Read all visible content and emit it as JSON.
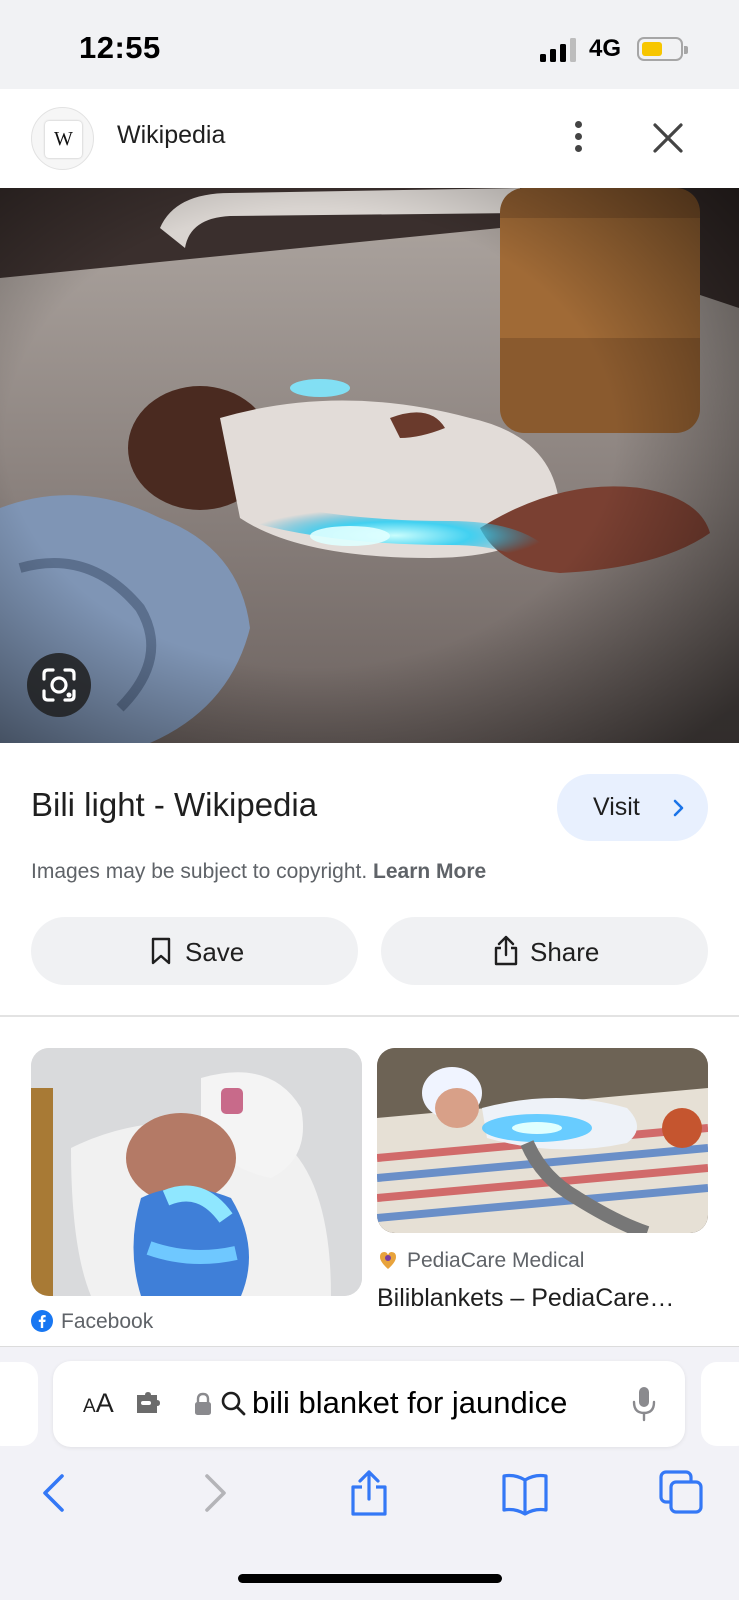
{
  "status_bar": {
    "time": "12:55",
    "network": "4G"
  },
  "header": {
    "logo_letter": "W",
    "site_name": "Wikipedia"
  },
  "result": {
    "title": "Bili light - Wikipedia",
    "visit_label": "Visit",
    "copyright_text": "Images may be subject to copyright.",
    "learn_more": "Learn More",
    "save_label": "Save",
    "share_label": "Share"
  },
  "related": [
    {
      "source": "Facebook",
      "title": ""
    },
    {
      "source": "PediaCare Medical",
      "title": "Biliblankets – PediaCare…"
    }
  ],
  "browser": {
    "aa_small": "A",
    "aa_large": "A",
    "address_text": "bili blanket for jaundice"
  },
  "colors": {
    "accent_blue": "#1a73e8",
    "visit_bg": "#e8f0fe",
    "battery": "#f7c600",
    "safari_blue": "#3478f6"
  }
}
